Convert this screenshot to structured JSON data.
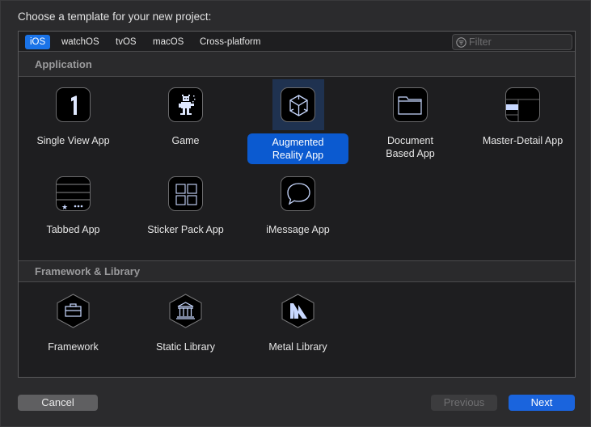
{
  "dialog": {
    "prompt": "Choose a template for your new project:"
  },
  "platform_tabs": [
    {
      "label": "iOS",
      "selected": true
    },
    {
      "label": "watchOS",
      "selected": false
    },
    {
      "label": "tvOS",
      "selected": false
    },
    {
      "label": "macOS",
      "selected": false
    },
    {
      "label": "Cross-platform",
      "selected": false
    }
  ],
  "filter": {
    "placeholder": "Filter",
    "value": "",
    "icon": "filter-icon"
  },
  "sections": [
    {
      "title": "Application",
      "templates": [
        {
          "label": "Single View App",
          "icon": "single-view-icon",
          "selected": false
        },
        {
          "label": "Game",
          "icon": "game-icon",
          "selected": false
        },
        {
          "label": "Augmented Reality App",
          "icon": "ar-cube-icon",
          "selected": true
        },
        {
          "label": "Document Based App",
          "icon": "folder-icon",
          "selected": false
        },
        {
          "label": "Master-Detail App",
          "icon": "master-detail-icon",
          "selected": false
        },
        {
          "label": "Tabbed App",
          "icon": "tabbed-icon",
          "selected": false
        },
        {
          "label": "Sticker Pack App",
          "icon": "sticker-grid-icon",
          "selected": false
        },
        {
          "label": "iMessage App",
          "icon": "message-bubble-icon",
          "selected": false
        }
      ]
    },
    {
      "title": "Framework & Library",
      "templates": [
        {
          "label": "Framework",
          "icon": "toolbox-icon",
          "selected": false
        },
        {
          "label": "Static Library",
          "icon": "library-building-icon",
          "selected": false
        },
        {
          "label": "Metal Library",
          "icon": "metal-icon",
          "selected": false
        }
      ]
    }
  ],
  "buttons": {
    "cancel": "Cancel",
    "previous": "Previous",
    "next": "Next"
  },
  "colors": {
    "accent": "#1a73e8",
    "selection_label": "#0b5ad0",
    "selection_bg": "#1f3250",
    "icon_stroke": "#c8d8ff"
  }
}
